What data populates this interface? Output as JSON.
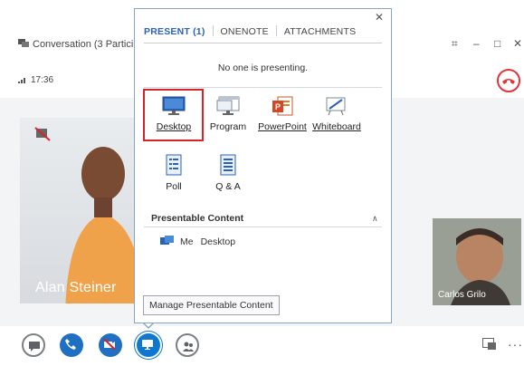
{
  "window": {
    "title": "Conversation (3 Participa",
    "time": "17:36"
  },
  "stage": {
    "main_participant": "Alan Steiner",
    "thumb_participant": "Carlos Grilo"
  },
  "popup": {
    "tabs": [
      {
        "label": "PRESENT (1)",
        "active": true
      },
      {
        "label": "ONENOTE",
        "active": false
      },
      {
        "label": "ATTACHMENTS",
        "active": false
      }
    ],
    "status": "No one is presenting.",
    "options": [
      {
        "label": "Desktop",
        "icon": "monitor-icon",
        "selected": true
      },
      {
        "label": "Program",
        "icon": "program-window-icon"
      },
      {
        "label": "PowerPoint",
        "icon": "powerpoint-icon"
      },
      {
        "label": "Whiteboard",
        "icon": "whiteboard-icon"
      },
      {
        "label": "Poll",
        "icon": "poll-icon"
      },
      {
        "label": "Q & A",
        "icon": "qa-icon"
      }
    ],
    "presentable": {
      "header": "Presentable Content",
      "item_owner": "Me",
      "item_name": "Desktop"
    },
    "manage_button": "Manage Presentable Content"
  },
  "colors": {
    "accent": "#2b62b5",
    "selection": "#d8232a",
    "hangup": "#e2343a",
    "control_blue": "#1f6fc3"
  }
}
